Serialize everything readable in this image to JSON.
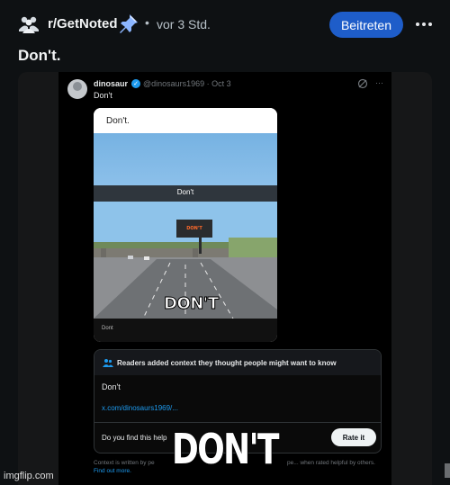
{
  "header": {
    "subreddit": "r/GetNoted",
    "separator": "•",
    "time": "vor 3 Std.",
    "join_label": "Beitreten",
    "accent": "#1e5dc9"
  },
  "post": {
    "title": "Don't."
  },
  "tweet": {
    "name": "dinosaur",
    "handle": "@dinosaurs1969 · Oct 3",
    "more": "···",
    "text": "Don't",
    "image": {
      "top_text": "Don't.",
      "band_text": "Don't",
      "sign_text": "DON'T",
      "caption": "DON'T",
      "bottom_text": "Dont"
    },
    "note": {
      "heading": "Readers added context they thought people might want to know",
      "body": "Don't",
      "link": "x.com/dinosaurs1969/...",
      "question": "Do you find this help",
      "rate_label": "Rate it",
      "footer_left": "Context is written by pe",
      "footer_right": "pe... when rated helpful by others.",
      "learn_more": "Find out more."
    }
  },
  "overlay": {
    "caption": "DON'T",
    "watermark": "imgflip.com"
  },
  "icons": {
    "subreddit": "subreddit-people-icon",
    "pin": "pin-icon",
    "more": "more-horizontal-icon",
    "verified": "verified-badge-icon",
    "grok": "grok-icon",
    "people": "people-icon"
  }
}
